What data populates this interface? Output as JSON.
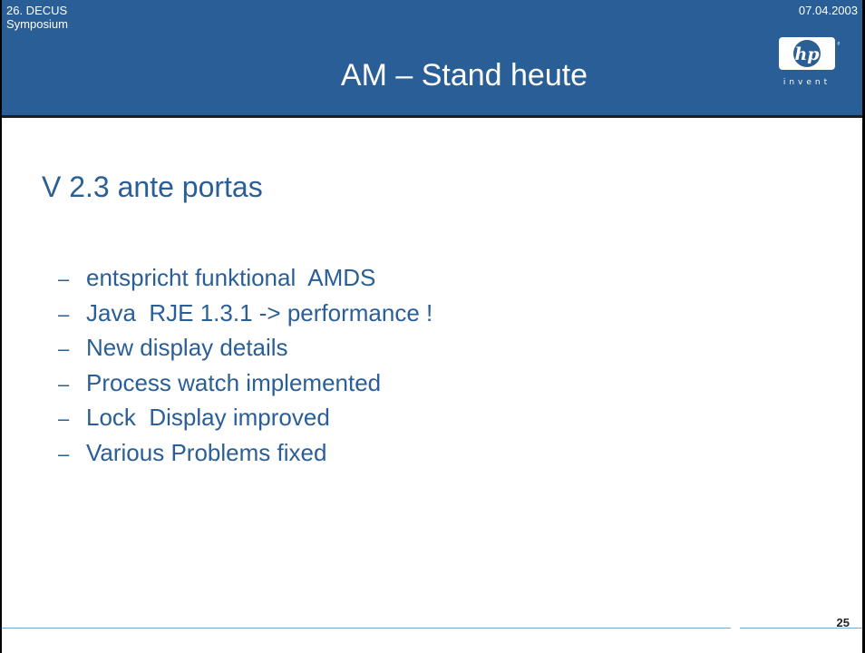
{
  "header": {
    "event_line1": "26. DECUS",
    "event_line2": "Symposium",
    "date": "07.04.2003",
    "title": "AM – Stand heute",
    "logo_text": "invent",
    "logo_mark": "hp"
  },
  "content": {
    "heading": "V 2.3 ante portas",
    "bullet_marker": "–",
    "bullets": [
      "entspricht funktional  AMDS",
      "Java  RJE 1.3.1 -> performance !",
      "New display details",
      "Process watch implemented",
      "Lock  Display improved",
      "Various Problems fixed"
    ]
  },
  "footer": {
    "page_number": "25"
  },
  "colors": {
    "header_bg": "#2a5e96",
    "text_blue": "#2a5e96",
    "white": "#ffffff"
  }
}
